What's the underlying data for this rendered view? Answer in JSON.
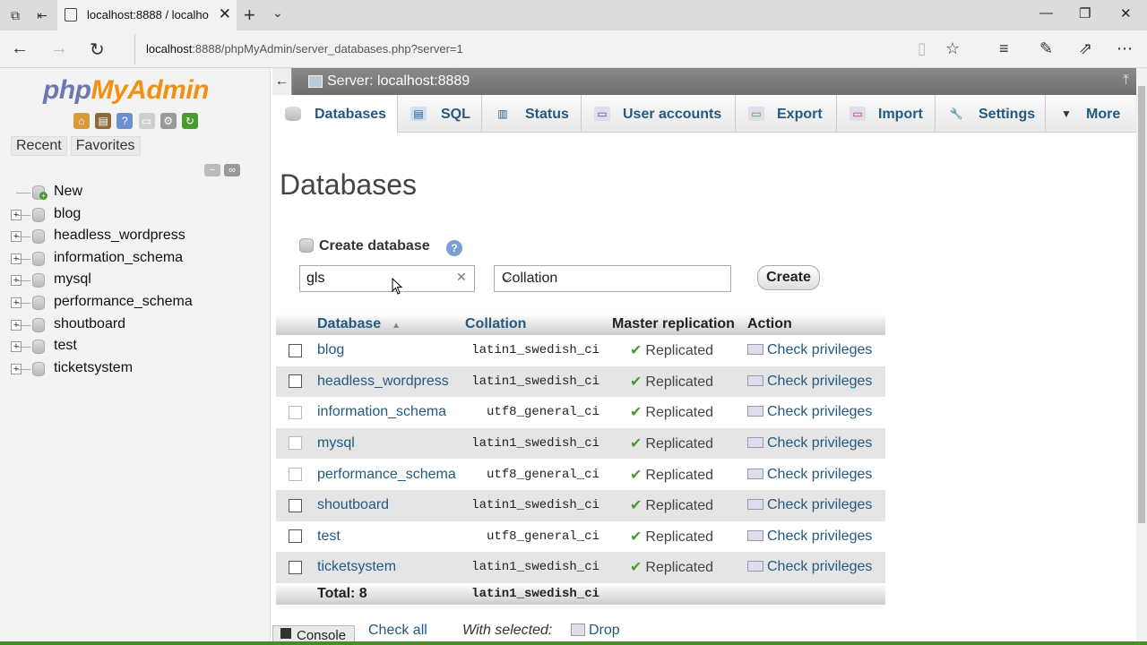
{
  "browser": {
    "tab_title": "localhost:8888 / localho",
    "url_host": "localhost",
    "url_rest": ":8888/phpMyAdmin/server_databases.php?server=1"
  },
  "left": {
    "logo_php": "php",
    "logo_my": "MyAdmin",
    "tabs": [
      "Recent",
      "Favorites"
    ],
    "tree": [
      "New",
      "blog",
      "headless_wordpress",
      "information_schema",
      "mysql",
      "performance_schema",
      "shoutboard",
      "test",
      "ticketsystem"
    ]
  },
  "server_bar": {
    "label": "Server: localhost:8889"
  },
  "menu": [
    "Databases",
    "SQL",
    "Status",
    "User accounts",
    "Export",
    "Import",
    "Settings",
    "More"
  ],
  "page": {
    "title": "Databases",
    "create_label": "Create database",
    "db_name_value": "gls",
    "collation_placeholder": "Collation",
    "create_button": "Create"
  },
  "table": {
    "headers": {
      "database": "Database",
      "collation": "Collation",
      "replication": "Master replication",
      "action": "Action"
    },
    "rows": [
      {
        "name": "blog",
        "collation": "latin1_swedish_ci",
        "replication": "Replicated",
        "action": "Check privileges"
      },
      {
        "name": "headless_wordpress",
        "collation": "latin1_swedish_ci",
        "replication": "Replicated",
        "action": "Check privileges"
      },
      {
        "name": "information_schema",
        "collation": "utf8_general_ci",
        "replication": "Replicated",
        "action": "Check privileges"
      },
      {
        "name": "mysql",
        "collation": "latin1_swedish_ci",
        "replication": "Replicated",
        "action": "Check privileges"
      },
      {
        "name": "performance_schema",
        "collation": "utf8_general_ci",
        "replication": "Replicated",
        "action": "Check privileges"
      },
      {
        "name": "shoutboard",
        "collation": "latin1_swedish_ci",
        "replication": "Replicated",
        "action": "Check privileges"
      },
      {
        "name": "test",
        "collation": "utf8_general_ci",
        "replication": "Replicated",
        "action": "Check privileges"
      },
      {
        "name": "ticketsystem",
        "collation": "latin1_swedish_ci",
        "replication": "Replicated",
        "action": "Check privileges"
      }
    ],
    "total_label": "Total: 8",
    "total_collation": "latin1_swedish_ci"
  },
  "bottom": {
    "check_all": "Check all",
    "with_selected": "With selected:",
    "drop": "Drop",
    "console": "Console"
  },
  "colors": {
    "link": "#235a81",
    "logo_php": "#6c78af",
    "logo_my": "#f29111",
    "check_green": "#4a9b2f"
  }
}
